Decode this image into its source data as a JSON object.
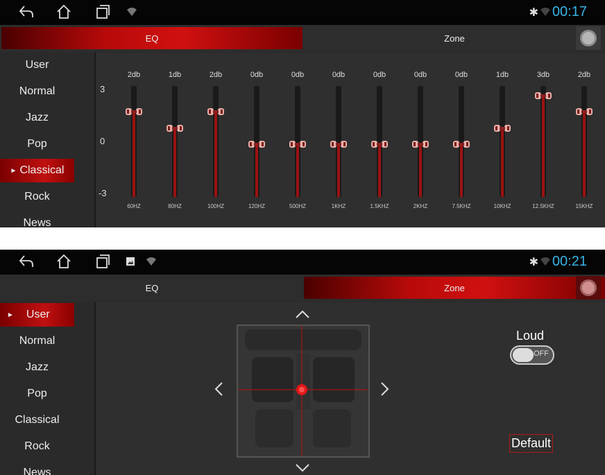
{
  "screens": [
    {
      "statusbar": {
        "time": "00:17",
        "show_image_icon": false
      },
      "tabs": [
        {
          "label": "EQ",
          "active": true
        },
        {
          "label": "Zone",
          "active": false
        }
      ],
      "sidebar": [
        {
          "label": "User",
          "active": false
        },
        {
          "label": "Normal",
          "active": false
        },
        {
          "label": "Jazz",
          "active": false
        },
        {
          "label": "Pop",
          "active": false
        },
        {
          "label": "Classical",
          "active": true
        },
        {
          "label": "Rock",
          "active": false
        },
        {
          "label": "News",
          "active": false
        }
      ],
      "eq": {
        "scale": [
          "3",
          "0",
          "-3"
        ],
        "range": [
          -3,
          3
        ],
        "bands": [
          {
            "freq": "60HZ",
            "label": "2db",
            "value": 2
          },
          {
            "freq": "80HZ",
            "label": "1db",
            "value": 1
          },
          {
            "freq": "100HZ",
            "label": "2db",
            "value": 2
          },
          {
            "freq": "120HZ",
            "label": "0db",
            "value": 0
          },
          {
            "freq": "500HZ",
            "label": "0db",
            "value": 0
          },
          {
            "freq": "1KHZ",
            "label": "0db",
            "value": 0
          },
          {
            "freq": "1.5KHZ",
            "label": "0db",
            "value": 0
          },
          {
            "freq": "2KHZ",
            "label": "0db",
            "value": 0
          },
          {
            "freq": "7.5KHZ",
            "label": "0db",
            "value": 0
          },
          {
            "freq": "10KHZ",
            "label": "1db",
            "value": 1
          },
          {
            "freq": "12.5KHZ",
            "label": "3db",
            "value": 3
          },
          {
            "freq": "15KHZ",
            "label": "2db",
            "value": 2
          }
        ]
      }
    },
    {
      "statusbar": {
        "time": "00:21",
        "show_image_icon": true
      },
      "tabs": [
        {
          "label": "EQ",
          "active": false
        },
        {
          "label": "Zone",
          "active": true
        }
      ],
      "sidebar": [
        {
          "label": "User",
          "active": true
        },
        {
          "label": "Normal",
          "active": false
        },
        {
          "label": "Jazz",
          "active": false
        },
        {
          "label": "Pop",
          "active": false
        },
        {
          "label": "Classical",
          "active": false
        },
        {
          "label": "Rock",
          "active": false
        },
        {
          "label": "News",
          "active": false
        }
      ],
      "zone": {
        "loud_label": "Loud",
        "loud_state": "OFF",
        "default_label": "Default"
      }
    }
  ],
  "colors": {
    "accent_red": "#c01010",
    "clock_blue": "#39b3e8"
  }
}
